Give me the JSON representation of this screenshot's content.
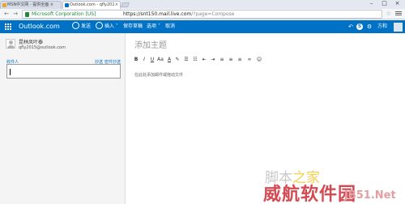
{
  "browser": {
    "tabs": [
      {
        "label": "MSN中文网 - 提供全面 ×",
        "active": false,
        "close": "×"
      },
      {
        "label": "Outlook.com - qfly201",
        "active": true,
        "close": "×"
      }
    ],
    "window_controls": {
      "minimize": "–",
      "maximize": "□",
      "close": "×"
    },
    "back": "←",
    "forward": "→",
    "ev_cert": "Microsoft Corporation [US]",
    "url_host": "https://snt150.mail.live.com",
    "url_path": "/?page=Compose",
    "colors": {
      "secure": "#1c8a36",
      "brand": "#0072c6"
    }
  },
  "topnav": {
    "brand": "Outlook.com",
    "send": "发送",
    "insert": "插入",
    "save_draft": "保存草稿",
    "options": "选项",
    "cancel": "取消",
    "username": "方和"
  },
  "compose": {
    "sender_name": "昆林凤叶泰",
    "sender_email": "qfly2015@outlook.com",
    "to_label": "收件人",
    "cc": "抄送",
    "bcc": "密件抄送",
    "to_value": "",
    "subject_placeholder": "添加主题",
    "body_placeholder": "在此处添加邮件或拖动文件"
  },
  "format_toolbar": [
    {
      "name": "bold-icon",
      "glyph": "B"
    },
    {
      "name": "italic-icon",
      "glyph": "I"
    },
    {
      "name": "underline-icon",
      "glyph": "U"
    },
    {
      "name": "font-size-icon",
      "glyph": "Aa"
    },
    {
      "name": "font-color-icon",
      "glyph": "A"
    },
    {
      "name": "highlight-icon",
      "glyph": "✎"
    },
    {
      "name": "bullet-list-icon",
      "glyph": "☰"
    },
    {
      "name": "numbered-list-icon",
      "glyph": "☷"
    },
    {
      "name": "outdent-icon",
      "glyph": "⇤"
    },
    {
      "name": "indent-icon",
      "glyph": "⇥"
    },
    {
      "name": "align-left-icon",
      "glyph": "≡"
    },
    {
      "name": "align-center-icon",
      "glyph": "≡"
    },
    {
      "name": "align-right-icon",
      "glyph": "≡"
    },
    {
      "name": "link-icon",
      "glyph": "∞"
    },
    {
      "name": "emoji-icon",
      "glyph": "☺"
    }
  ],
  "watermark": {
    "line1_a": "脚本",
    "line1_b": "之家",
    "line2": "威航软件园",
    "line3": "JB51.Net"
  }
}
